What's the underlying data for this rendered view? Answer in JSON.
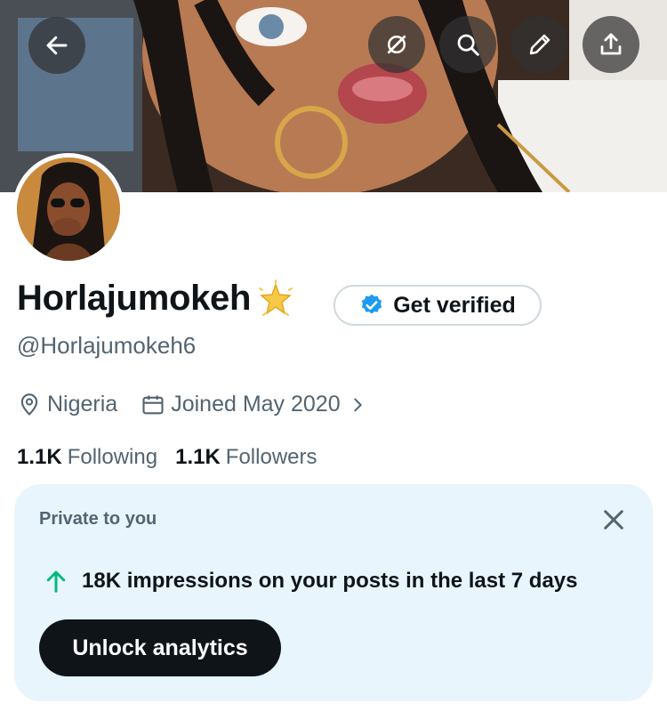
{
  "header": {
    "banner_icon": "banner-image",
    "buttons": [
      "back-arrow-icon",
      "grok-icon",
      "search-icon",
      "edit-pencil-icon",
      "share-upload-icon"
    ]
  },
  "profile": {
    "display_name": "Horlajumokeh",
    "name_emoji": "🌟",
    "verify_button_label": "Get verified",
    "handle": "@Horlajumokeh6",
    "location": "Nigeria",
    "joined": "Joined May 2020",
    "following_count": "1.1K",
    "following_label": "Following",
    "followers_count": "1.1K",
    "followers_label": "Followers"
  },
  "insight_card": {
    "tag": "Private to you",
    "stat": "18K impressions on your posts in the last 7 days",
    "button_label": "Unlock analytics",
    "colors": {
      "background": "#e8f5fd",
      "arrow": "#00ba7c"
    }
  },
  "colors": {
    "verified_blue": "#1d9bf0",
    "text_primary": "#0f1419",
    "text_secondary": "#536471"
  }
}
